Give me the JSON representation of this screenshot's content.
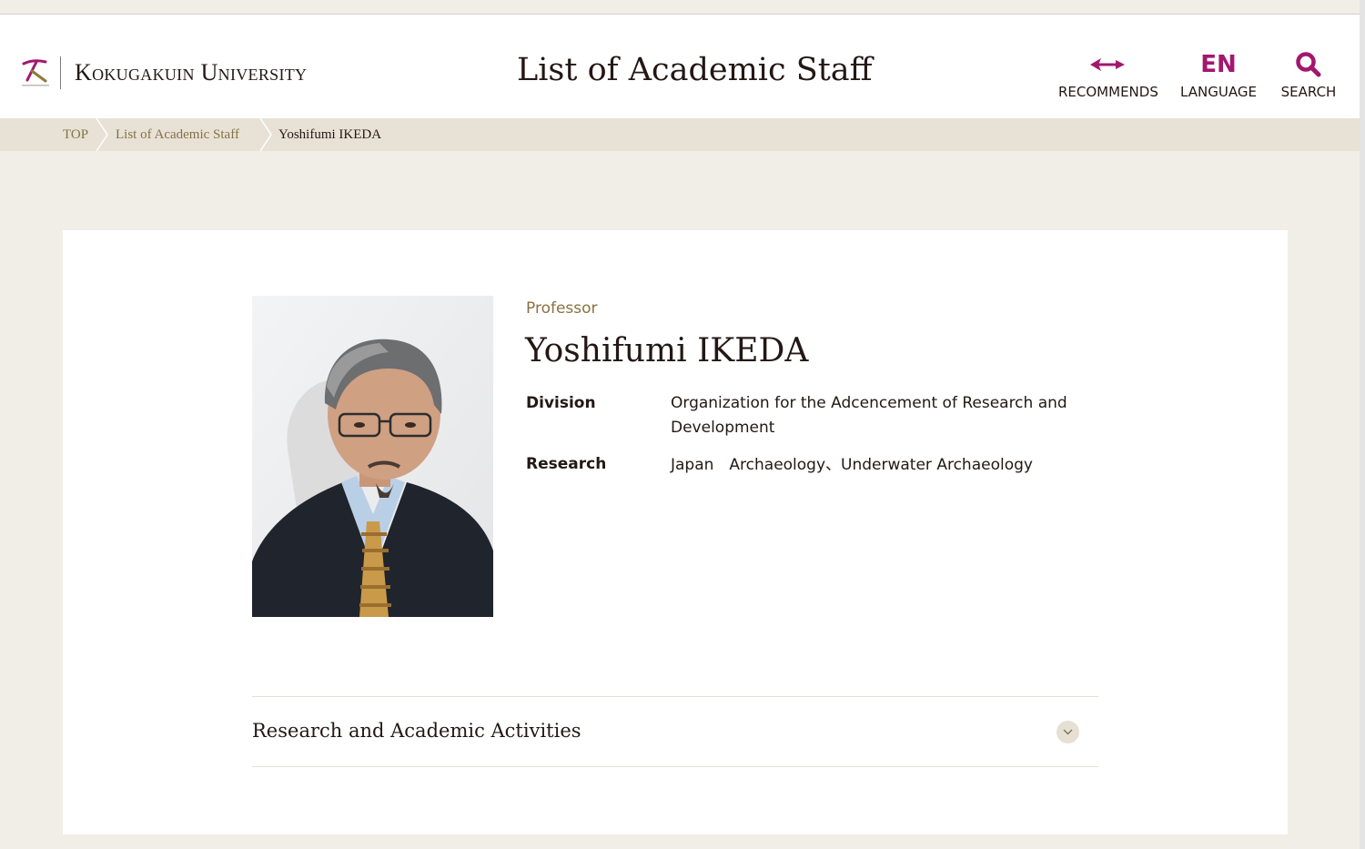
{
  "header": {
    "logo_alt": "KOKUGAKUIN UNIVERSITY",
    "logo_text": "Kokugakuin University",
    "page_title": "List of Academic Staff",
    "nav": {
      "recommends_label": "RECOMMENDS",
      "language_code": "EN",
      "language_label": "LANGUAGE",
      "search_label": "SEARCH"
    },
    "brand_color": "#a3176e"
  },
  "breadcrumb": {
    "items": [
      {
        "label": "TOP"
      },
      {
        "label": "List of Academic Staff"
      },
      {
        "label": "Yoshifumi IKEDA"
      }
    ]
  },
  "profile": {
    "role": "Professor",
    "name": "Yoshifumi IKEDA",
    "fields": [
      {
        "label": "Division",
        "value": "Organization for the Adcencement of Research and Development"
      },
      {
        "label": "Research",
        "value": "Japan　Archaeology、Underwater Archaeology"
      }
    ]
  },
  "accordion": {
    "title": "Research and Academic Activities",
    "icon": "chevron-down-icon"
  }
}
